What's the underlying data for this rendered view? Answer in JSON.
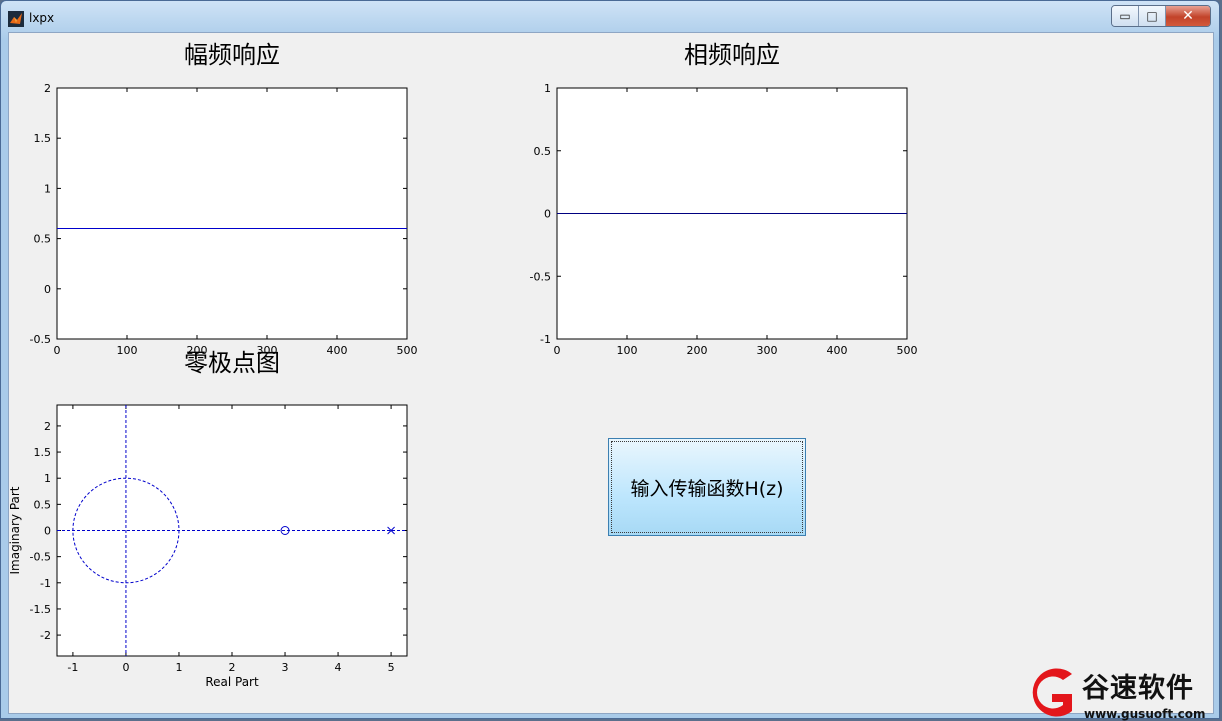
{
  "window": {
    "title": "lxpx",
    "minimize_glyph": "▭",
    "maximize_glyph": "□",
    "close_glyph": "✕"
  },
  "colors": {
    "line": "#0000cc",
    "accent_button": "#bde6fd"
  },
  "chart_data": [
    {
      "type": "line",
      "title": "幅频响应",
      "xlim": [
        0,
        500
      ],
      "ylim": [
        -0.5,
        2
      ],
      "xticks": [
        0,
        100,
        200,
        300,
        400,
        500
      ],
      "yticks": [
        -0.5,
        0,
        0.5,
        1,
        1.5,
        2
      ],
      "x": [
        0,
        500
      ],
      "series": [
        {
          "values": [
            0.6,
            0.6
          ]
        }
      ]
    },
    {
      "type": "line",
      "title": "相频响应",
      "xlim": [
        0,
        500
      ],
      "ylim": [
        -1,
        1
      ],
      "xticks": [
        0,
        100,
        200,
        300,
        400,
        500
      ],
      "yticks": [
        -1,
        -0.5,
        0,
        0.5,
        1
      ],
      "x": [
        0,
        500
      ],
      "series": [
        {
          "values": [
            0,
            0
          ]
        }
      ]
    },
    {
      "type": "scatter",
      "title": "零极点图",
      "xlabel": "Real Part",
      "ylabel": "Imaginary Part",
      "xlim": [
        -1.3,
        5.3
      ],
      "ylim": [
        -2.4,
        2.4
      ],
      "xticks": [
        -1,
        0,
        1,
        2,
        3,
        4,
        5
      ],
      "yticks": [
        -2,
        -1.5,
        -1,
        -0.5,
        0,
        0.5,
        1,
        1.5,
        2
      ],
      "unit_circle_radius": 1,
      "zeros": [
        {
          "x": 3,
          "y": 0
        }
      ],
      "poles": [
        {
          "x": 5,
          "y": 0
        }
      ]
    }
  ],
  "button": {
    "label": "输入传输函数H(z)"
  },
  "watermark": {
    "text": "谷速软件",
    "url": "www.gusuoft.com"
  }
}
